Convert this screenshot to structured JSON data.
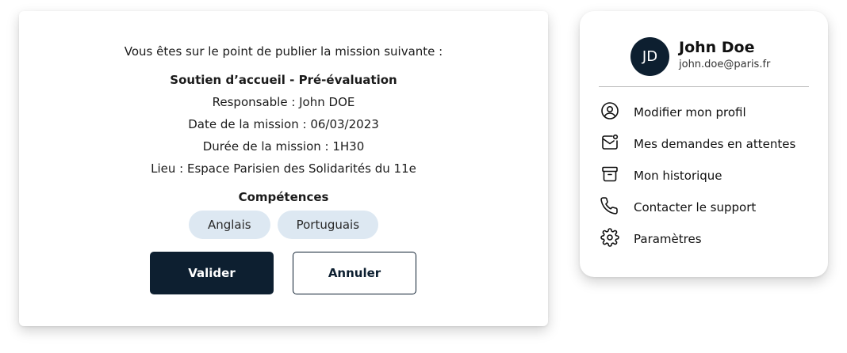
{
  "mission_dialog": {
    "intro": "Vous êtes sur le point de publier la mission suivante :",
    "mission_title": "Soutien d’accueil - Pré-évaluation",
    "responsible": "Responsable : John DOE",
    "date": "Date de la mission : 06/03/2023",
    "duration": "Durée de la mission : 1H30",
    "location": "Lieu : Espace Parisien des Solidarités du 11e",
    "skills_heading": "Compétences",
    "skills": [
      "Anglais",
      "Portuguais"
    ],
    "confirm_label": "Valider",
    "cancel_label": "Annuler",
    "primary_color": "#0d1f30",
    "chip_color": "#dde8f2"
  },
  "profile_menu": {
    "initials": "JD",
    "name": "John Doe",
    "email": "john.doe@paris.fr",
    "items": [
      {
        "label": "Modifier mon profil",
        "icon": "user-circle-icon"
      },
      {
        "label": "Mes demandes en attentes",
        "icon": "mail-notification-icon"
      },
      {
        "label": "Mon historique",
        "icon": "archive-icon"
      },
      {
        "label": "Contacter le support",
        "icon": "phone-icon"
      },
      {
        "label": "Paramètres",
        "icon": "gear-icon"
      }
    ]
  }
}
